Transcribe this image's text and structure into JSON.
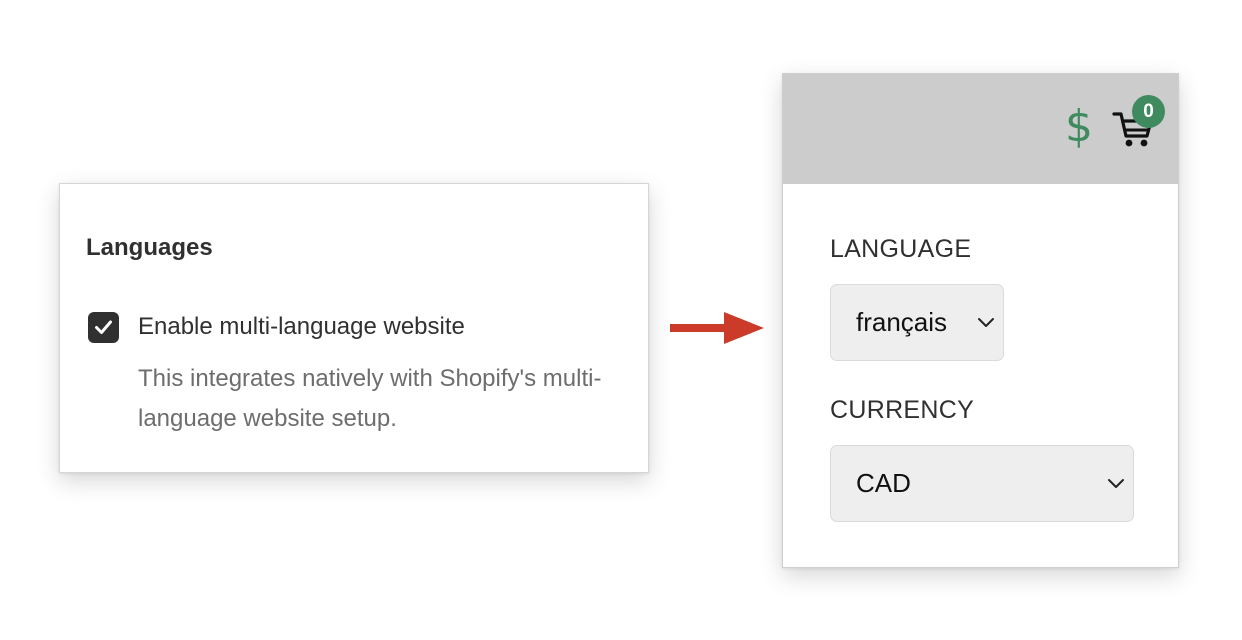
{
  "settings": {
    "title": "Languages",
    "checkbox": {
      "checked": true,
      "label": "Enable multi-language website",
      "help_text": "This integrates natively with Shopify's multi-language website setup."
    }
  },
  "arrow": {
    "color": "#cc3a2a",
    "icon": "arrow-right-icon"
  },
  "storefront": {
    "header": {
      "background": "#cccccc",
      "currency_icon": "$",
      "currency_icon_color": "#3f8a5e",
      "cart_icon": "shopping-cart-icon",
      "cart_count": "0",
      "badge_color": "#3f8a5e"
    },
    "language": {
      "label": "LANGUAGE",
      "selected": "français"
    },
    "currency": {
      "label": "CURRENCY",
      "selected": "CAD"
    }
  }
}
